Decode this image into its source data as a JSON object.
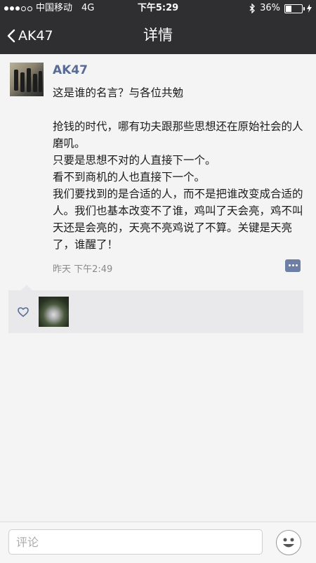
{
  "status_bar": {
    "carrier": "中国移动",
    "network": "4G",
    "time": "下午5:29",
    "battery_text": "36%",
    "battery_level": 0.36
  },
  "nav": {
    "back_label": "AK47",
    "title": "详情"
  },
  "post": {
    "author": "AK47",
    "text": "这是谁的名言？与各位共勉\n\n抢钱的时代，哪有功夫跟那些思想还在原始社会的人磨叽。\n只要是思想不对的人直接下一个。\n看不到商机的人也直接下一个。\n我们要找到的是合适的人，而不是把谁改变成合适的人。我们也基本改变不了谁，鸡叫了天会亮，鸡不叫天还是会亮的，天亮不亮鸡说了不算。关键是天亮了，谁醒了！",
    "timestamp": "昨天 下午2:49"
  },
  "comment_bar": {
    "placeholder": "评论"
  },
  "icons": {
    "back": "chevron-left-icon",
    "bluetooth": "bluetooth-icon",
    "charging": "charging-icon",
    "comment": "comment-icon",
    "like": "heart-icon",
    "emoji": "emoji-icon"
  }
}
